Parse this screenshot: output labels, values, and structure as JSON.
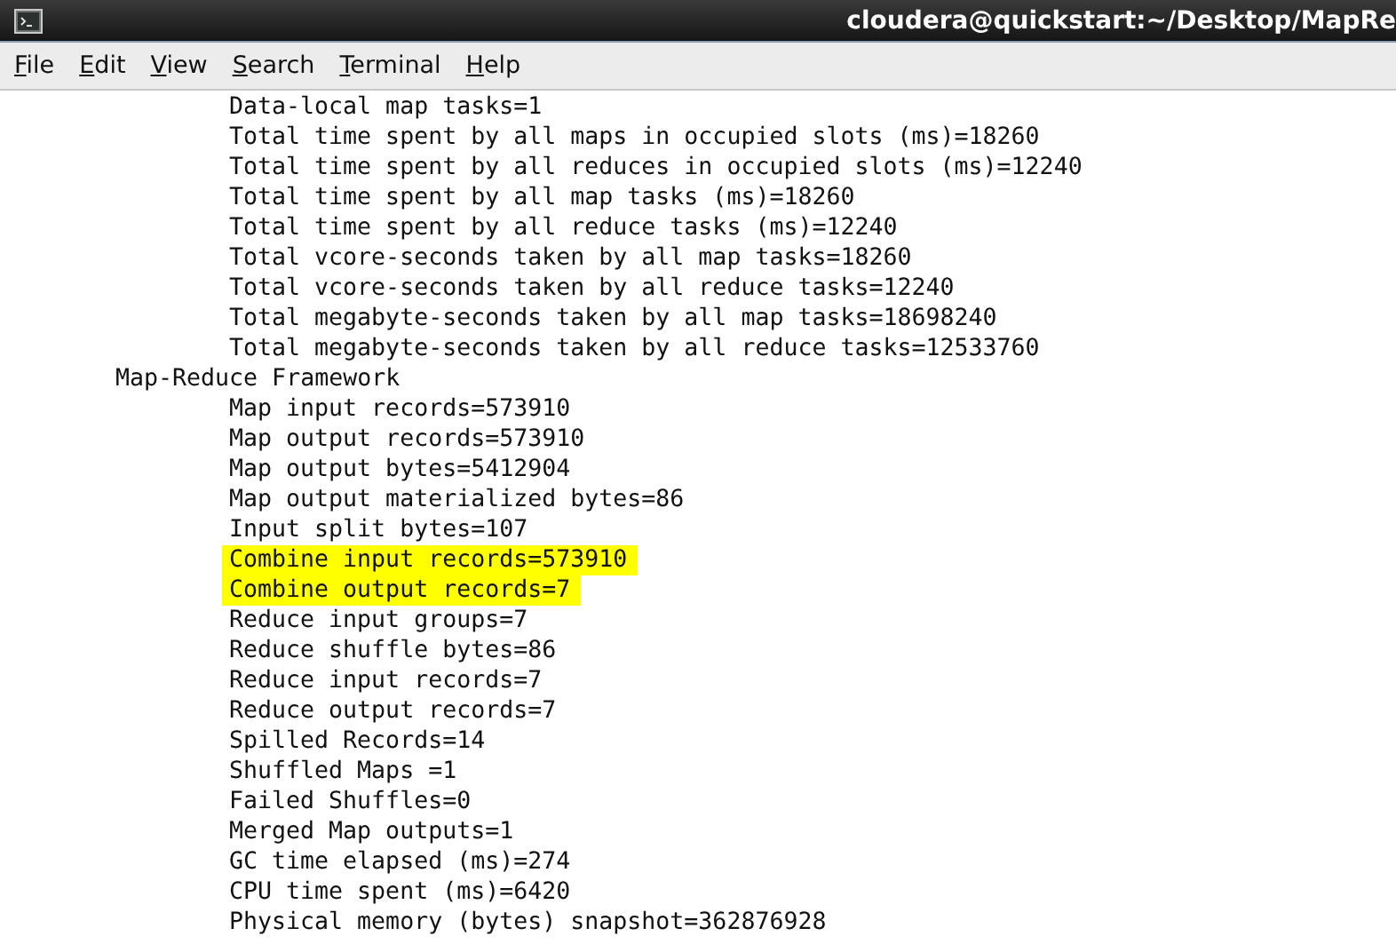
{
  "window": {
    "title": "cloudera@quickstart:~/Desktop/MapRe"
  },
  "menu": [
    "File",
    "Edit",
    "View",
    "Search",
    "Terminal",
    "Help"
  ],
  "terminal": {
    "continued_lines": [
      {
        "text": "Data-local map tasks=1",
        "highlighted": false
      },
      {
        "text": "Total time spent by all maps in occupied slots (ms)=18260",
        "highlighted": false
      },
      {
        "text": "Total time spent by all reduces in occupied slots (ms)=12240",
        "highlighted": false
      },
      {
        "text": "Total time spent by all map tasks (ms)=18260",
        "highlighted": false
      },
      {
        "text": "Total time spent by all reduce tasks (ms)=12240",
        "highlighted": false
      },
      {
        "text": "Total vcore-seconds taken by all map tasks=18260",
        "highlighted": false
      },
      {
        "text": "Total vcore-seconds taken by all reduce tasks=12240",
        "highlighted": false
      },
      {
        "text": "Total megabyte-seconds taken by all map tasks=18698240",
        "highlighted": false
      },
      {
        "text": "Total megabyte-seconds taken by all reduce tasks=12533760",
        "highlighted": false
      }
    ],
    "sections": [
      {
        "heading": "Map-Reduce Framework",
        "lines": [
          {
            "text": "Map input records=573910",
            "highlighted": false
          },
          {
            "text": "Map output records=573910",
            "highlighted": false
          },
          {
            "text": "Map output bytes=5412904",
            "highlighted": false
          },
          {
            "text": "Map output materialized bytes=86",
            "highlighted": false
          },
          {
            "text": "Input split bytes=107",
            "highlighted": false
          },
          {
            "text": "Combine input records=573910",
            "highlighted": true
          },
          {
            "text": "Combine output records=7",
            "highlighted": true
          },
          {
            "text": "Reduce input groups=7",
            "highlighted": false
          },
          {
            "text": "Reduce shuffle bytes=86",
            "highlighted": false
          },
          {
            "text": "Reduce input records=7",
            "highlighted": false
          },
          {
            "text": "Reduce output records=7",
            "highlighted": false
          },
          {
            "text": "Spilled Records=14",
            "highlighted": false
          },
          {
            "text": "Shuffled Maps =1",
            "highlighted": false
          },
          {
            "text": "Failed Shuffles=0",
            "highlighted": false
          },
          {
            "text": "Merged Map outputs=1",
            "highlighted": false
          },
          {
            "text": "GC time elapsed (ms)=274",
            "highlighted": false
          },
          {
            "text": "CPU time spent (ms)=6420",
            "highlighted": false
          },
          {
            "text": "Physical memory (bytes) snapshot=362876928",
            "highlighted": false
          }
        ]
      }
    ]
  }
}
